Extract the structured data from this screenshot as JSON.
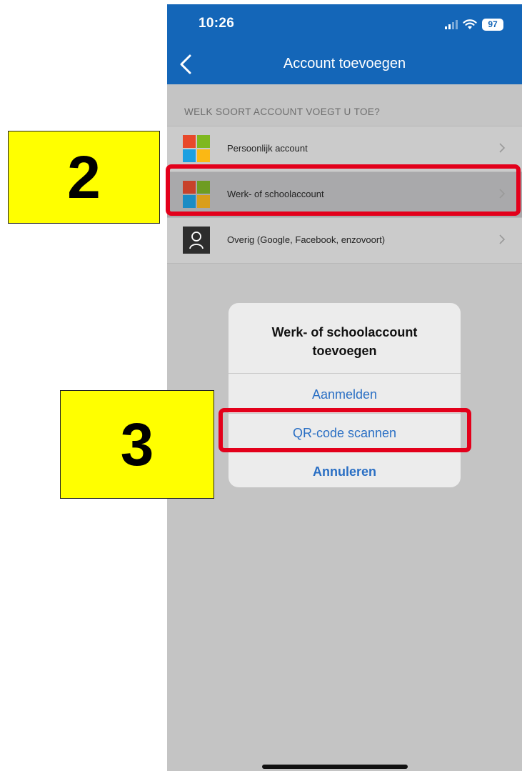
{
  "status_bar": {
    "time": "10:26",
    "battery": "97"
  },
  "nav": {
    "title": "Account toevoegen"
  },
  "section": {
    "header": "WELK SOORT ACCOUNT VOEGT U TOE?"
  },
  "accounts": [
    {
      "label": "Persoonlijk account",
      "icon": "microsoft-logo-icon"
    },
    {
      "label": "Werk- of schoolaccount",
      "icon": "microsoft-logo-icon"
    },
    {
      "label": "Overig (Google, Facebook, enzovoort)",
      "icon": "person-icon"
    }
  ],
  "dialog": {
    "title_line1": "Werk- of schoolaccount",
    "title_line2": "toevoegen",
    "login": "Aanmelden",
    "qr": "QR-code scannen",
    "cancel": "Annuleren"
  },
  "annotations": {
    "step2": "2",
    "step3": "3"
  },
  "colors": {
    "header": "#1466b8",
    "highlight": "#e3001b",
    "step_box": "#ffff00",
    "ms_red": "#e8492b",
    "ms_green": "#7fb81f",
    "ms_blue": "#1ba0e1",
    "ms_yellow": "#fbb814"
  }
}
